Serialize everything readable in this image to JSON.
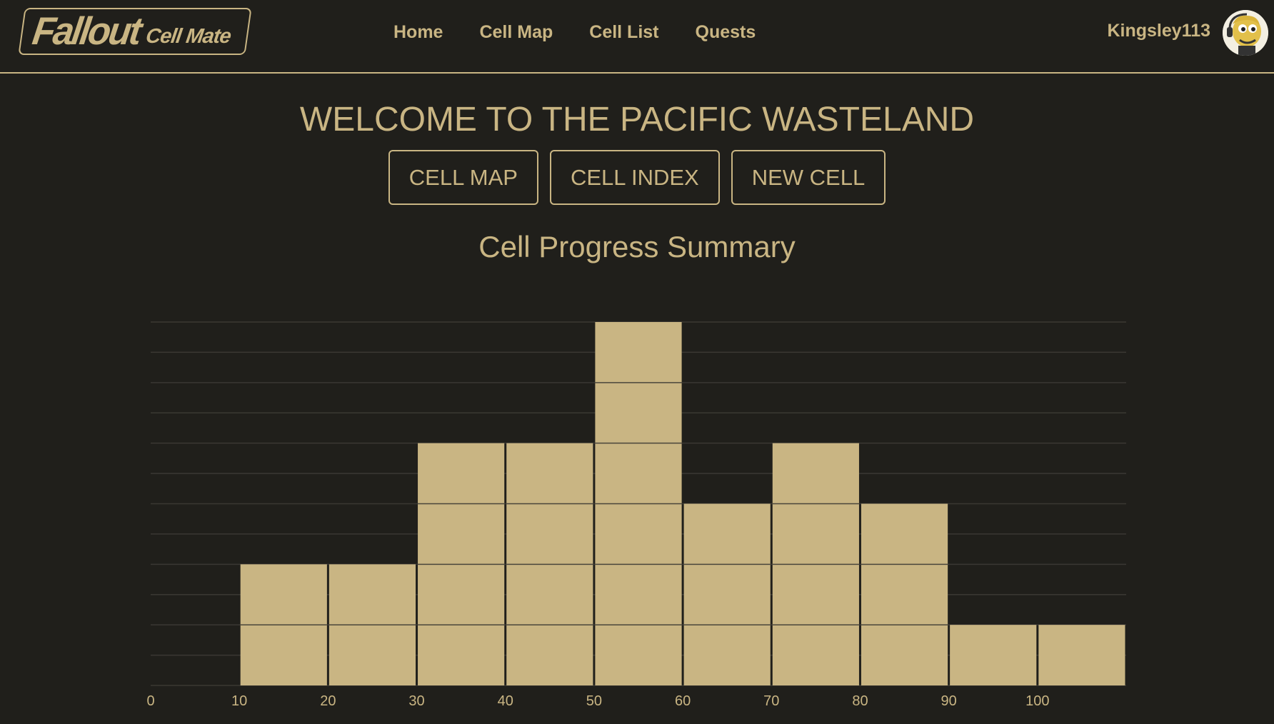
{
  "header": {
    "logo_main": "Fallout",
    "logo_sub": "Cell Mate",
    "nav": [
      "Home",
      "Cell Map",
      "Cell List",
      "Quests"
    ],
    "username": "Kingsley113"
  },
  "main": {
    "title": "WELCOME TO THE PACIFIC WASTELAND",
    "buttons": [
      "CELL MAP",
      "CELL INDEX",
      "NEW CELL"
    ],
    "summary_title": "Cell Progress Summary"
  },
  "colors": {
    "background": "#201f1b",
    "accent": "#c9b583"
  },
  "icons": {
    "avatar": "vault-boy-avatar-icon"
  },
  "chart_data": {
    "type": "bar",
    "bins": [
      [
        0,
        10
      ],
      [
        10,
        20
      ],
      [
        20,
        30
      ],
      [
        30,
        40
      ],
      [
        40,
        50
      ],
      [
        50,
        60
      ],
      [
        60,
        70
      ],
      [
        70,
        80
      ],
      [
        80,
        90
      ],
      [
        90,
        100
      ],
      [
        100,
        110
      ]
    ],
    "values": [
      0,
      2,
      2,
      4,
      4,
      6,
      3,
      4,
      3,
      1,
      1
    ],
    "x_ticks": [
      0,
      10,
      20,
      30,
      40,
      50,
      60,
      70,
      80,
      90,
      100
    ],
    "xlim": [
      0,
      110
    ],
    "ylim": [
      0,
      6
    ],
    "grid": true
  }
}
